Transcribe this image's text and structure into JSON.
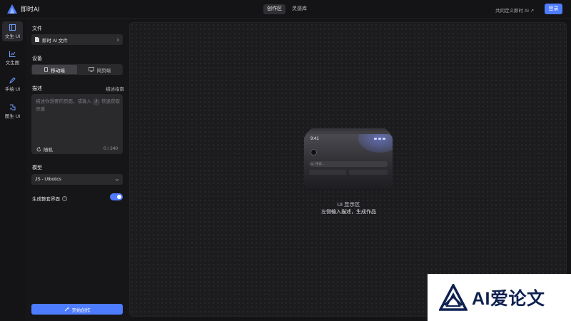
{
  "app": {
    "name": "即时AI"
  },
  "header": {
    "tabs": [
      {
        "label": "创作区",
        "active": true
      },
      {
        "label": "灵感库",
        "active": false
      }
    ],
    "share_link": "共同定义即时 AI ↗",
    "login_label": "登录"
  },
  "rail": {
    "items": [
      {
        "label": "文生 UI",
        "icon": "layout-icon",
        "active": true
      },
      {
        "label": "文生图",
        "icon": "chart-icon",
        "active": false
      },
      {
        "label": "手绘 UI",
        "icon": "pen-icon",
        "active": false
      },
      {
        "label": "图生 UI",
        "icon": "image-to-ui-icon",
        "active": false
      }
    ]
  },
  "panel": {
    "file_label": "文件",
    "file_select": "即时 AI 文件",
    "device_label": "设备",
    "device_options": [
      {
        "label": "移动端",
        "icon": "phone-icon",
        "active": true
      },
      {
        "label": "网页端",
        "icon": "monitor-icon",
        "active": false
      }
    ],
    "description_label": "描述",
    "description_guide": "描述指南",
    "description_placeholder_a": "描述你想要的页面，或输入",
    "description_shortcut": "/",
    "description_placeholder_b": "快速获取灵感",
    "random_label": "随机",
    "char_count": "0 / 240",
    "model_label": "模型",
    "model_value": "JS - UIbotics",
    "fullpage_label": "生成整套界面",
    "fullpage_enabled": true,
    "start_label": "开始创作"
  },
  "canvas": {
    "mock_time": "9:41",
    "mock_search": "搜索...",
    "title": "UI 显示区",
    "subtitle": "左侧输入描述，生成作品"
  },
  "watermark": {
    "text": "AI爱论文"
  },
  "colors": {
    "accent": "#4e7cff",
    "background": "#141416",
    "panel": "#2a2a2d"
  }
}
